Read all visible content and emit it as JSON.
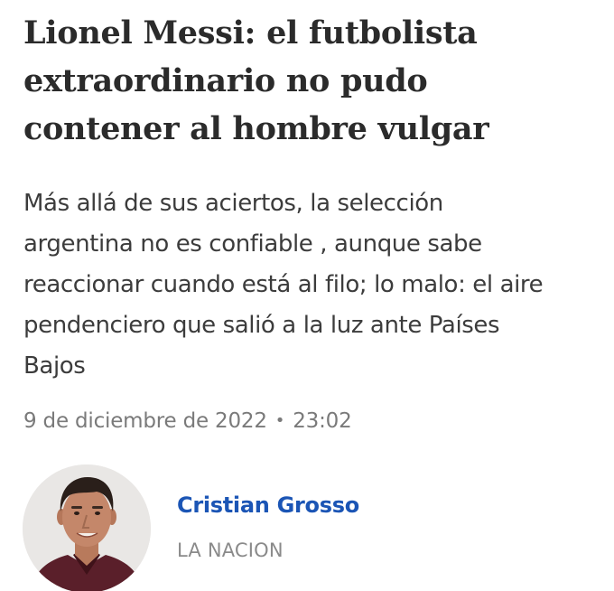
{
  "article": {
    "headline_lines": [
      "Lionel Messi: el futbolista",
      "extraordinario no pudo",
      "contener al hombre vulgar"
    ],
    "dek_lines": [
      "Más allá de sus aciertos, la selección",
      "argentina no es confiable , aunque sabe",
      "reaccionar cuando está al filo; lo malo: el aire",
      "pendenciero que salió a la luz ante Países",
      "Bajos"
    ],
    "date": "9 de diciembre de 2022",
    "separator": "•",
    "time": "23:02"
  },
  "author": {
    "name": "Cristian Grosso",
    "outlet": "LA NACION",
    "avatar_icon": "author-photo",
    "name_color": "#1b55b5"
  }
}
